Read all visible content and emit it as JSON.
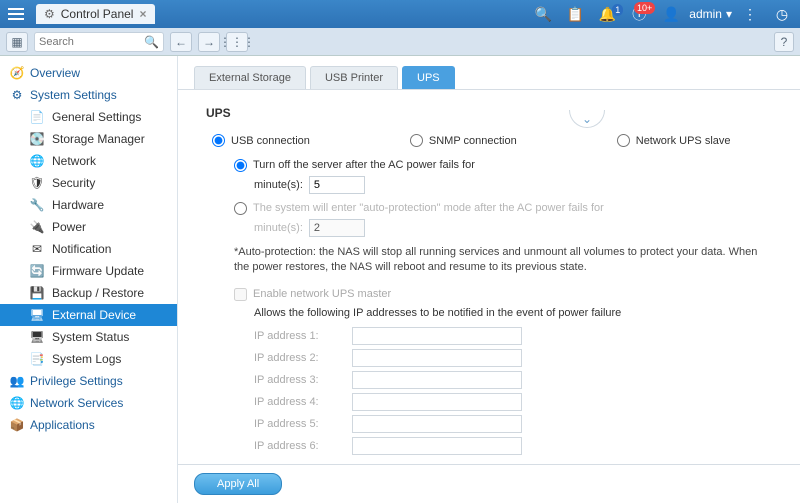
{
  "header": {
    "tab_title": "Control Panel",
    "user": "admin",
    "badge_bell": "1",
    "badge_info": "10+"
  },
  "toolbar": {
    "search_placeholder": "Search"
  },
  "sidebar": {
    "overview": "Overview",
    "system_settings": "System Settings",
    "items": [
      "General Settings",
      "Storage Manager",
      "Network",
      "Security",
      "Hardware",
      "Power",
      "Notification",
      "Firmware Update",
      "Backup / Restore",
      "External Device",
      "System Status",
      "System Logs"
    ],
    "privilege": "Privilege Settings",
    "network_services": "Network Services",
    "applications": "Applications"
  },
  "tabs": {
    "ext": "External Storage",
    "usb": "USB Printer",
    "ups": "UPS"
  },
  "ups": {
    "title": "UPS",
    "conn_usb": "USB connection",
    "conn_snmp": "SNMP connection",
    "conn_slave": "Network UPS slave",
    "opt1": "Turn off the server after the AC power fails for",
    "minutes": "minute(s):",
    "opt1_value": "5",
    "opt2": "The system will enter \"auto-protection\" mode after the AC power fails for",
    "opt2_value": "2",
    "note": "*Auto-protection: the NAS will stop all running services and unmount all volumes to protect your data. When the power restores, the NAS will reboot and resume to its previous state.",
    "enable_master": "Enable network UPS master",
    "allow": "Allows the following IP addresses to be notified in the event of power failure",
    "ip_labels": [
      "IP address 1:",
      "IP address 2:",
      "IP address 3:",
      "IP address 4:",
      "IP address 5:",
      "IP address 6:"
    ],
    "apply": "Apply All"
  }
}
